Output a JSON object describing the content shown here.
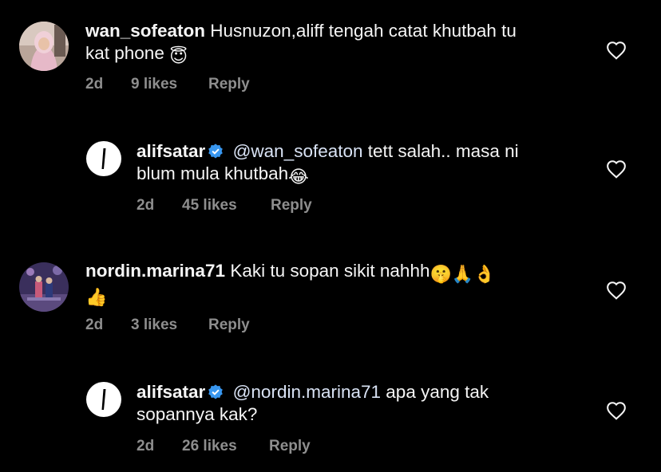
{
  "comments": [
    {
      "username": "wan_sofeaton",
      "verified": false,
      "mention": "",
      "text": "Husnuzon,aliff tengah catat khutbah tu kat phone",
      "text_line1": "Husnuzon,aliff tengah catat khutbah tu",
      "text_line2": "kat phone",
      "emoji": "😇",
      "age": "2d",
      "likes": "9 likes",
      "reply": "Reply"
    },
    {
      "username": "alifsatar",
      "verified": true,
      "mention": "@wan_sofeaton",
      "text_line1": "tett salah.. masa ni",
      "text_line2": "blum mula khutbah",
      "emoji": "😂",
      "age": "2d",
      "likes": "45 likes",
      "reply": "Reply"
    },
    {
      "username": "nordin.marina71",
      "verified": false,
      "mention": "",
      "text_line1": "Kaki tu sopan sikit nahhh",
      "emoji_line1": "🤫🙏👌",
      "emoji_line2": "👍",
      "age": "2d",
      "likes": "3 likes",
      "reply": "Reply"
    },
    {
      "username": "alifsatar",
      "verified": true,
      "mention": "@nordin.marina71",
      "text_line1": "apa yang tak",
      "text_line2": "sopannya kak?",
      "age": "2d",
      "likes": "26 likes",
      "reply": "Reply"
    }
  ],
  "icons": {
    "like": "heart-icon",
    "verified": "verified-badge-icon"
  },
  "colors": {
    "background": "#000000",
    "text": "#f5f5f5",
    "meta": "#8e8e8e",
    "mention": "#d9e3f5",
    "verified": "#3897f0"
  }
}
